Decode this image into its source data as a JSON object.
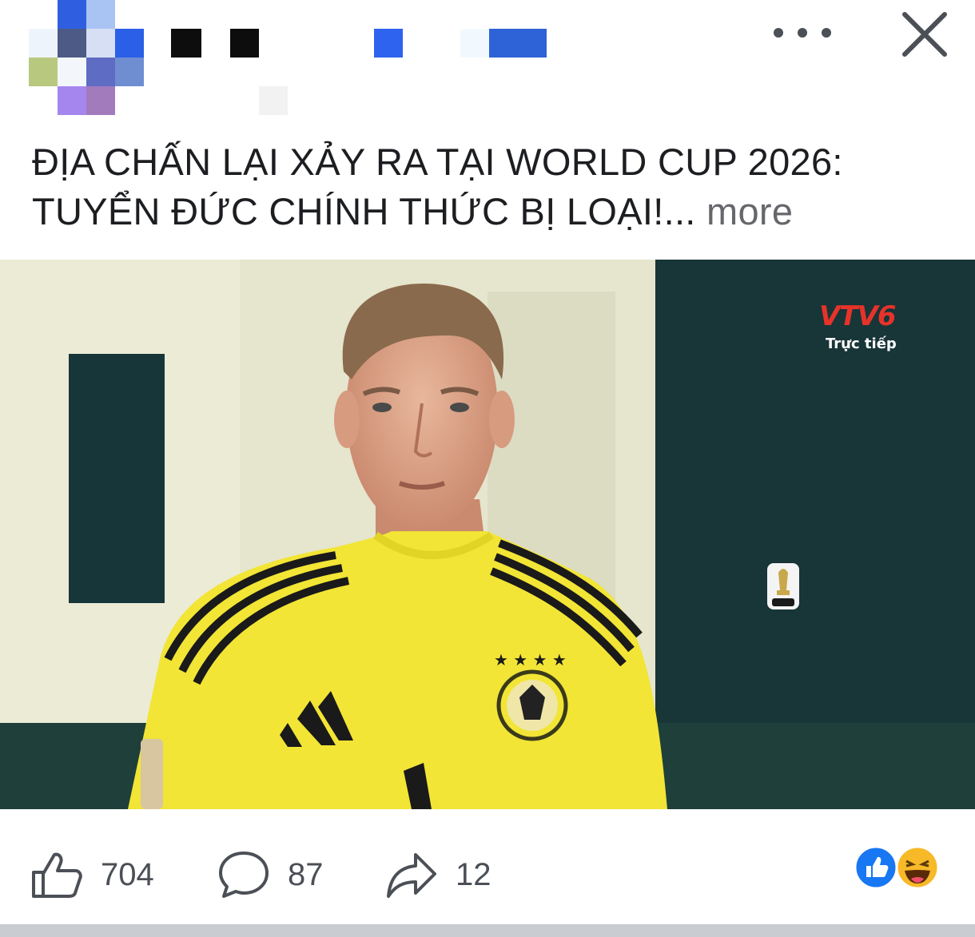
{
  "post": {
    "caption_line1": "ĐỊA CHẤN LẠI XẢY RA TẠI WORLD CUP 2026:",
    "caption_line2": "TUYỂN ĐỨC CHÍNH THỨC BỊ LOẠI!...",
    "see_more": "more"
  },
  "header": {
    "avatar_icon": "pixelated-avatar",
    "name_icon": "pixelated-name",
    "more_icon": "more-horizontal-icon",
    "close_icon": "close-icon"
  },
  "media": {
    "broadcaster_logo": "VTV6",
    "live_label": "Trực tiếp",
    "fifa_logo_icon": "fifa-world-cup-2026-logo"
  },
  "actions": {
    "likes": "704",
    "comments": "87",
    "shares": "12",
    "like_icon": "thumbs-up-icon",
    "comment_icon": "comment-bubble-icon",
    "share_icon": "share-arrow-icon",
    "reaction_icons": [
      "like-reaction-icon",
      "haha-reaction-icon"
    ]
  },
  "colors": {
    "text": "#1c1e21",
    "secondary_text": "#65676b",
    "like_blue": "#1877f2",
    "haha_yellow": "#f7b928",
    "jersey_yellow": "#f2e535"
  }
}
